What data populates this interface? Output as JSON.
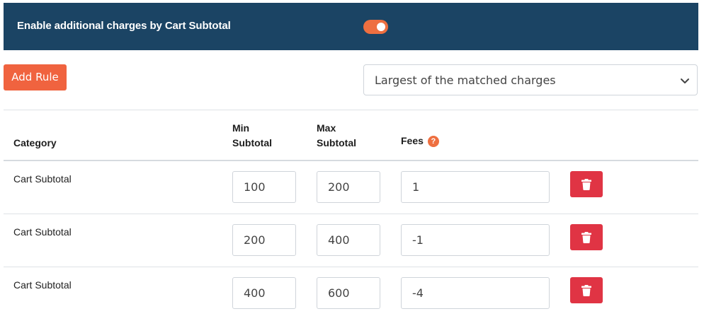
{
  "banner": {
    "title": "Enable additional charges by Cart Subtotal",
    "toggle_on": true,
    "toggle_color": "#ee6f40",
    "background": "#1b4464"
  },
  "toolbar": {
    "add_rule_label": "Add Rule",
    "select_value": "Largest of the matched charges"
  },
  "table": {
    "headers": {
      "category": "Category",
      "min_line1": "Min",
      "min_line2": "Subtotal",
      "max_line1": "Max",
      "max_line2": "Subtotal",
      "fees": "Fees",
      "fees_help_icon": "question-circle-icon"
    },
    "rows": [
      {
        "category": "Cart Subtotal",
        "min": "100",
        "max": "200",
        "fee": "1"
      },
      {
        "category": "Cart Subtotal",
        "min": "200",
        "max": "400",
        "fee": "-1"
      },
      {
        "category": "Cart Subtotal",
        "min": "400",
        "max": "600",
        "fee": "-4"
      }
    ],
    "delete_icon": "trash-icon",
    "delete_color": "#e03444"
  }
}
